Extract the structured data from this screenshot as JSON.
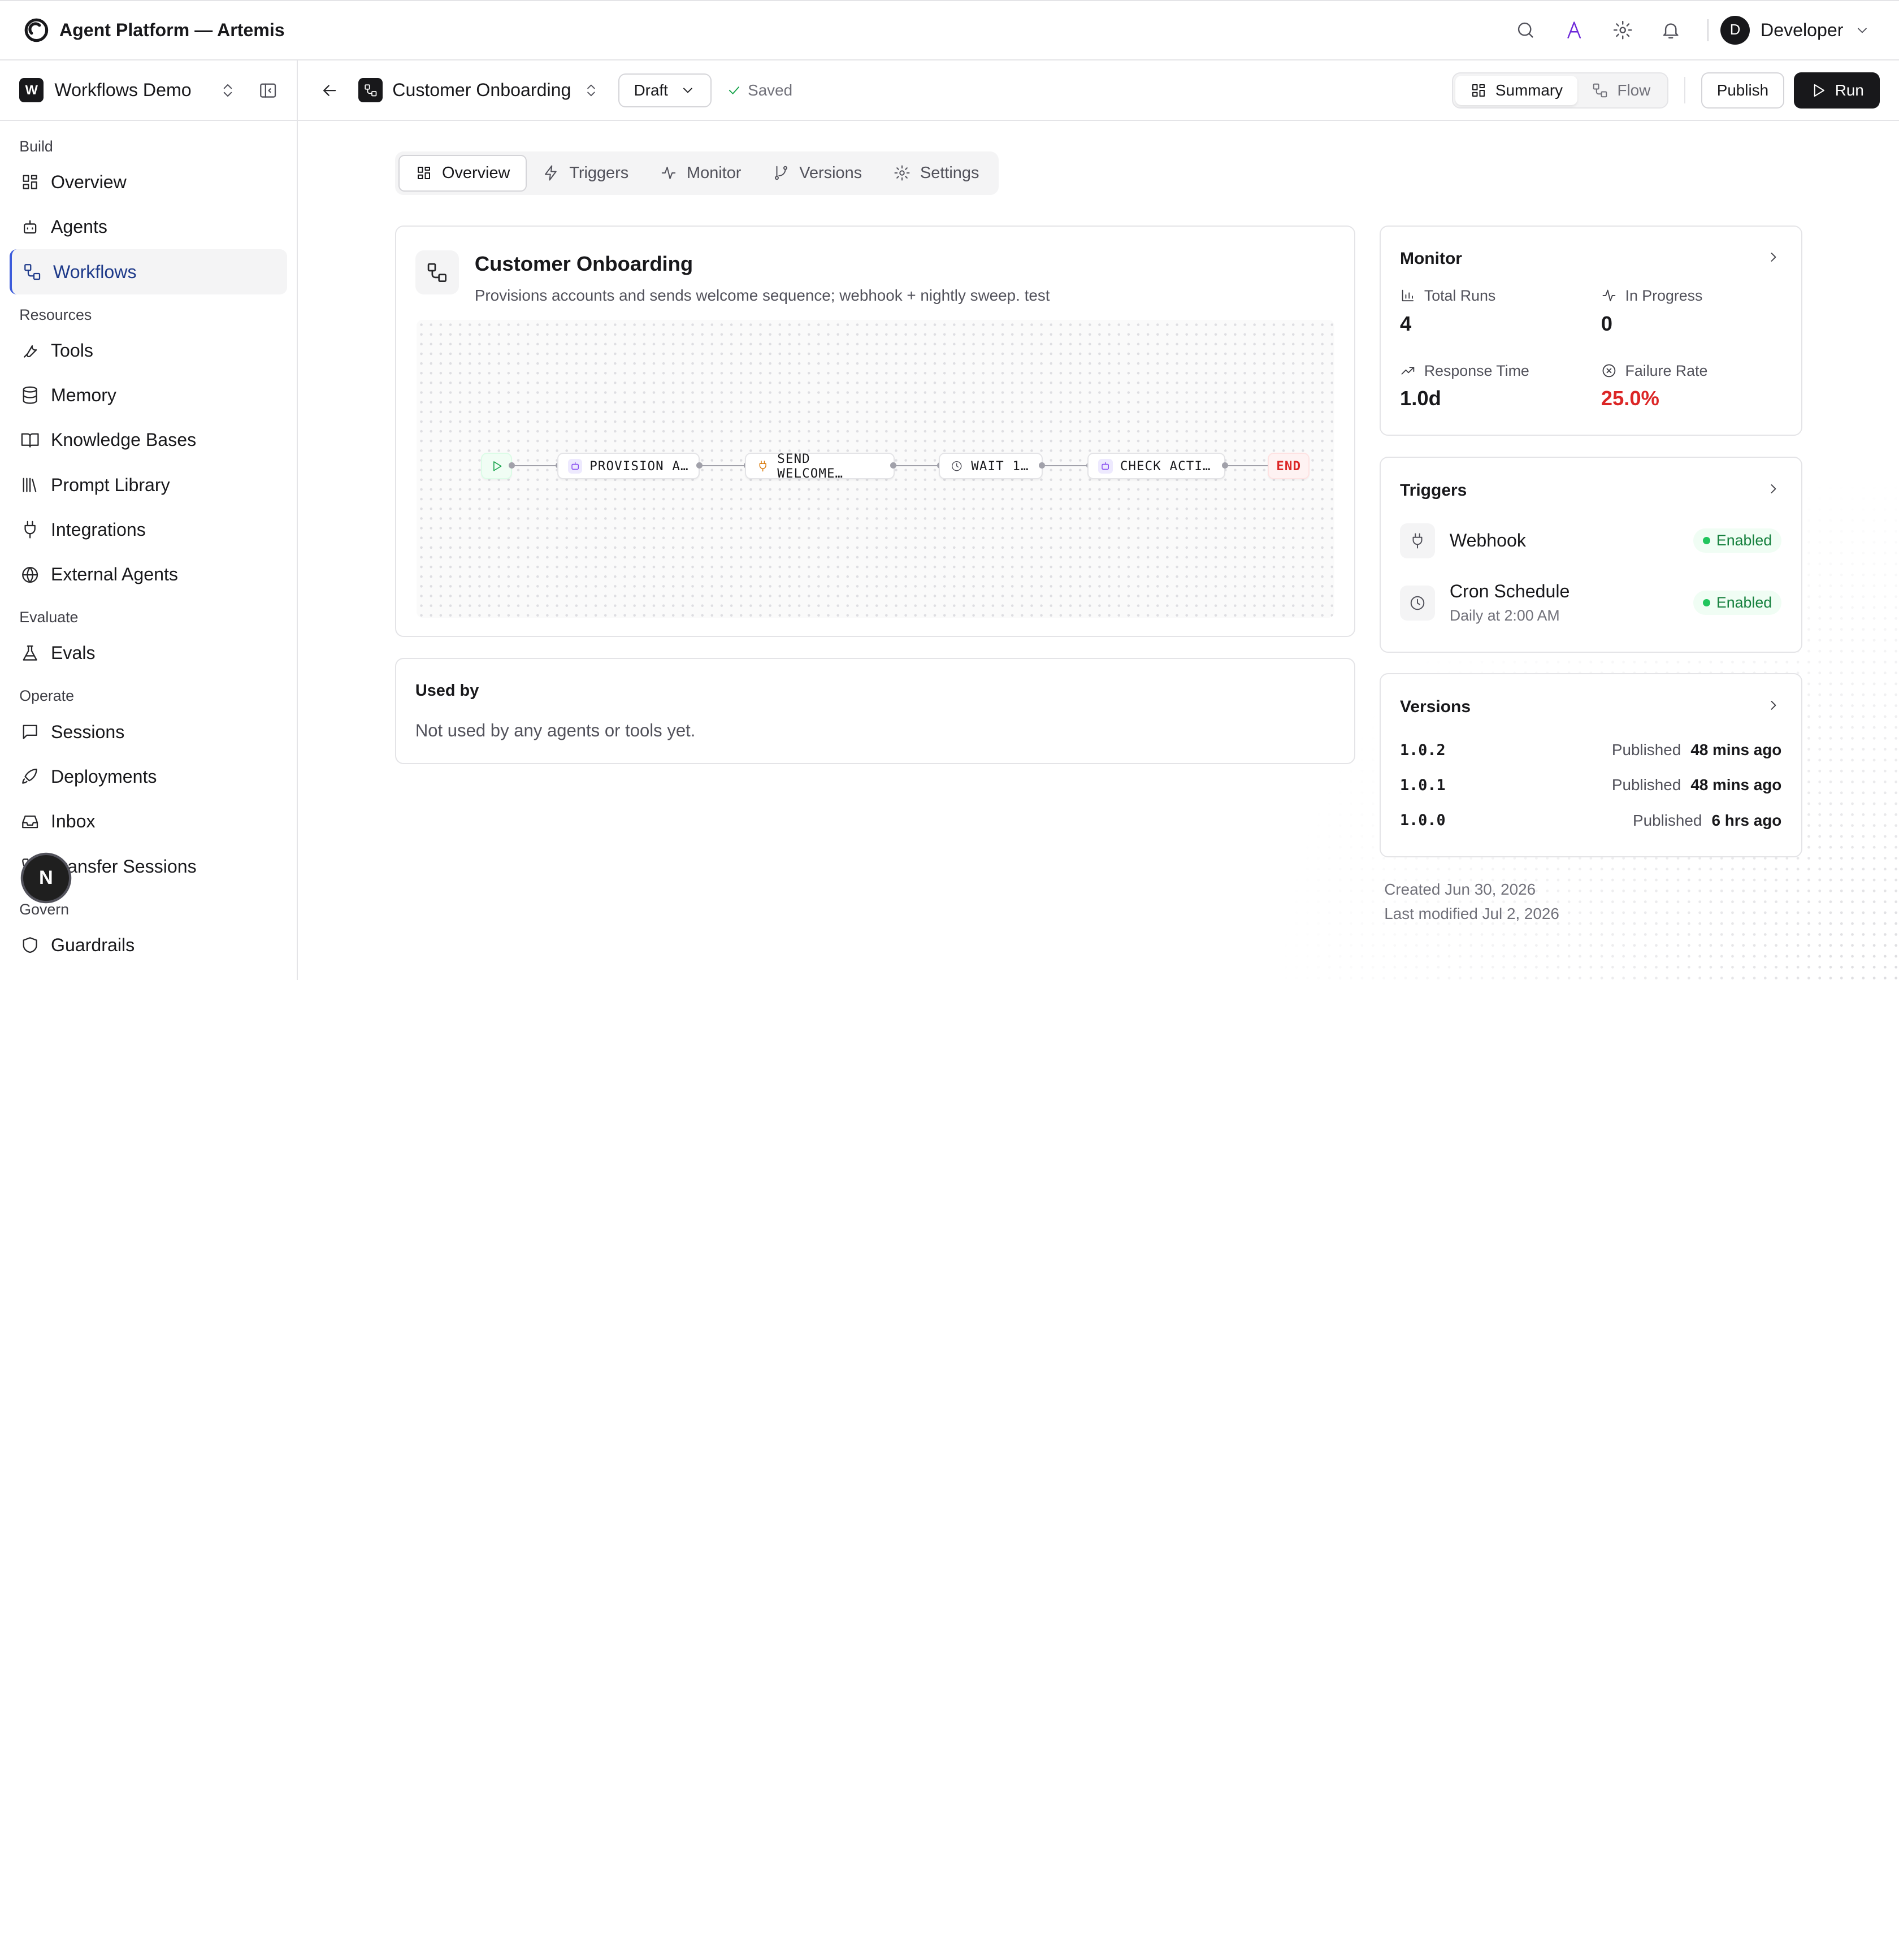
{
  "app": {
    "title": "Agent Platform — Artemis"
  },
  "user": {
    "initial": "D",
    "name": "Developer"
  },
  "workspace": {
    "badge": "W",
    "name": "Workflows Demo"
  },
  "sidebar": {
    "groups": {
      "build": "Build",
      "resources": "Resources",
      "evaluate": "Evaluate",
      "operate": "Operate",
      "govern": "Govern"
    },
    "items": {
      "overview": "Overview",
      "agents": "Agents",
      "workflows": "Workflows",
      "tools": "Tools",
      "memory": "Memory",
      "knowledge": "Knowledge Bases",
      "prompts": "Prompt Library",
      "integrations": "Integrations",
      "external": "External Agents",
      "evals": "Evals",
      "sessions": "Sessions",
      "deployments": "Deployments",
      "inbox": "Inbox",
      "transfer": "Transfer Sessions",
      "guardrails": "Guardrails"
    },
    "fab_label": "N"
  },
  "header": {
    "workflow_title": "Customer Onboarding",
    "status_select": "Draft",
    "saved_label": "Saved",
    "view_toggle": {
      "summary": "Summary",
      "flow": "Flow"
    },
    "publish": "Publish",
    "run": "Run"
  },
  "tabs": {
    "overview": "Overview",
    "triggers": "Triggers",
    "monitor": "Monitor",
    "versions": "Versions",
    "settings": "Settings"
  },
  "workflow": {
    "title": "Customer Onboarding",
    "description": "Provisions accounts and sends welcome sequence; webhook + nightly sweep. test",
    "nodes": [
      "PROVISION A…",
      "SEND WELCOME…",
      "WAIT 1…",
      "CHECK ACTI…"
    ],
    "end_label": "END"
  },
  "used_by": {
    "title": "Used by",
    "empty": "Not used by any agents or tools yet."
  },
  "monitor": {
    "title": "Monitor",
    "total_runs_label": "Total Runs",
    "total_runs": "4",
    "in_progress_label": "In Progress",
    "in_progress": "0",
    "response_time_label": "Response Time",
    "response_time": "1.0d",
    "failure_rate_label": "Failure Rate",
    "failure_rate": "25.0%"
  },
  "triggers": {
    "title": "Triggers",
    "items": [
      {
        "name": "Webhook",
        "sub": "",
        "status": "Enabled"
      },
      {
        "name": "Cron Schedule",
        "sub": "Daily at 2:00 AM",
        "status": "Enabled"
      }
    ]
  },
  "versions": {
    "title": "Versions",
    "items": [
      {
        "version": "1.0.2",
        "state": "Published",
        "ago": "48 mins ago"
      },
      {
        "version": "1.0.1",
        "state": "Published",
        "ago": "48 mins ago"
      },
      {
        "version": "1.0.0",
        "state": "Published",
        "ago": "6 hrs ago"
      }
    ]
  },
  "meta": {
    "created": "Created Jun 30, 2026",
    "modified": "Last modified Jul 2, 2026"
  },
  "colors": {
    "accent": "#1e3a8a",
    "danger": "#dc2626",
    "success": "#15803d",
    "dark": "#18181b"
  }
}
